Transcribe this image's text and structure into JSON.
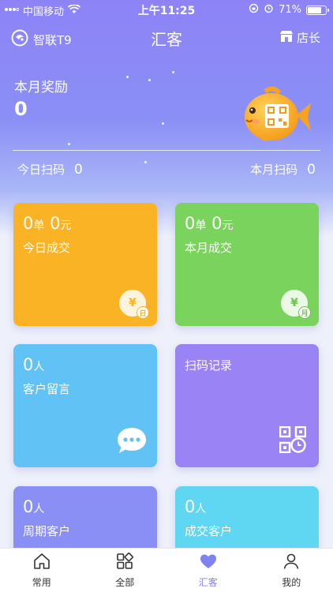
{
  "status_bar": {
    "carrier": "中国移动",
    "time": "上午11:25",
    "battery_pct": "71%",
    "battery_level": 0.71
  },
  "nav": {
    "brand": "智联T9",
    "title": "汇客",
    "shop_label": "店长"
  },
  "header": {
    "award_label": "本月奖励",
    "award_value": "0",
    "today_scan_label": "今日扫码",
    "today_scan_value": "0",
    "month_scan_label": "本月扫码",
    "month_scan_value": "0"
  },
  "cards": {
    "today_deal": {
      "orders": "0",
      "orders_unit": "单",
      "amount": "0",
      "amount_unit": "元",
      "label": "今日成交",
      "badge_symbol": "¥",
      "badge_mini": "日",
      "color": "#f9b325"
    },
    "month_deal": {
      "orders": "0",
      "orders_unit": "单",
      "amount": "0",
      "amount_unit": "元",
      "label": "本月成交",
      "badge_symbol": "¥",
      "badge_mini": "月",
      "color": "#7ad35d"
    },
    "messages": {
      "count": "0",
      "unit": "人",
      "label": "客户留言",
      "icon": "chat-bubble-icon",
      "color": "#61c2f6"
    },
    "scan_record": {
      "label": "扫码记录",
      "icon": "qr-clock-icon",
      "color": "#9a83f5"
    },
    "period_customers": {
      "count": "0",
      "unit": "人",
      "label": "周期客户",
      "color": "#8a8ff6"
    },
    "deal_customers": {
      "count": "0",
      "unit": "人",
      "label": "成交客户",
      "color": "#5fd6f2"
    }
  },
  "tabbar": {
    "items": [
      {
        "label": "常用",
        "icon": "home-icon"
      },
      {
        "label": "全部",
        "icon": "grid-icon"
      },
      {
        "label": "汇客",
        "icon": "heart-icon",
        "active": true
      },
      {
        "label": "我的",
        "icon": "user-icon"
      }
    ],
    "accent": "#7f83f2"
  }
}
